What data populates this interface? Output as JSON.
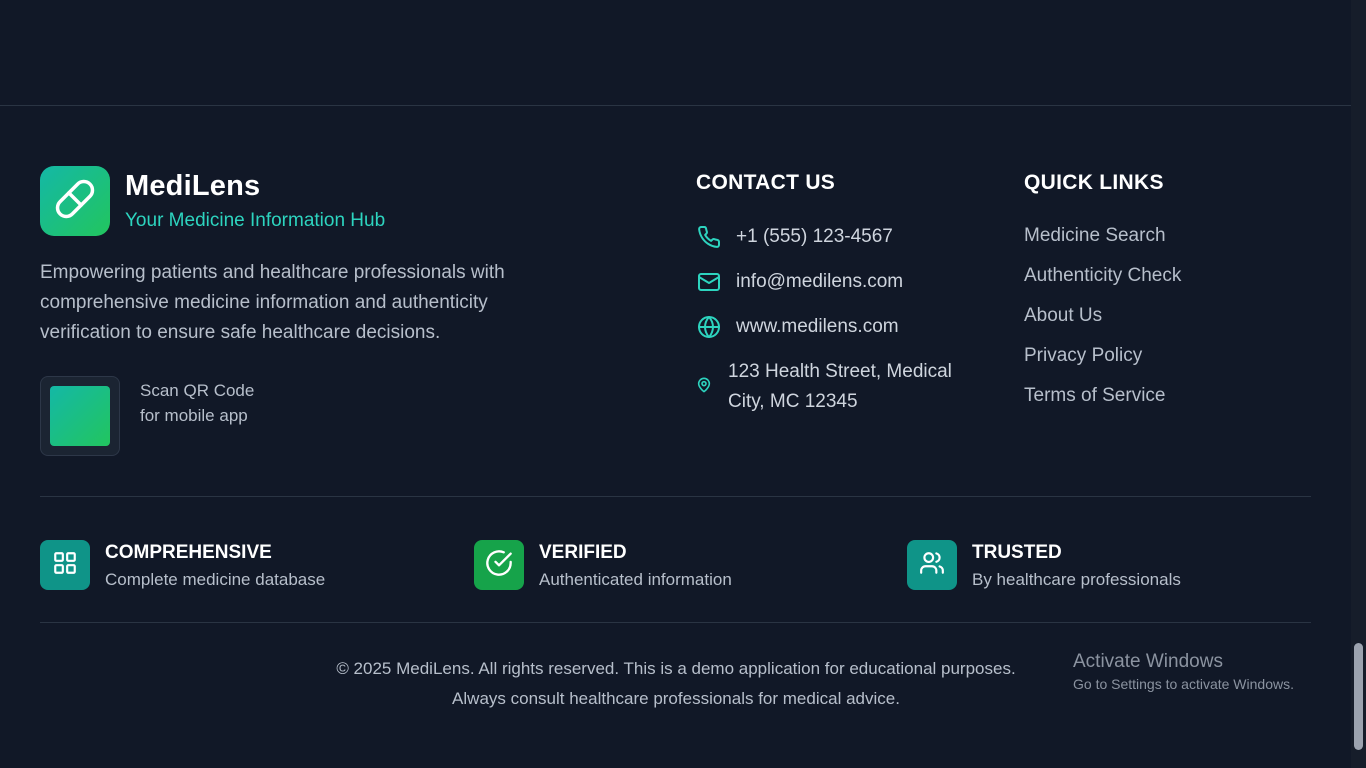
{
  "brand": {
    "name": "MediLens",
    "tagline": "Your Medicine Information Hub",
    "description": "Empowering patients and healthcare professionals with comprehensive medicine information and authenticity verification to ensure safe healthcare decisions.",
    "qr_line1": "Scan QR Code",
    "qr_line2": "for mobile app",
    "logo_icon": "pill-icon",
    "accent_color": "#2dd4bf"
  },
  "contact": {
    "title": "CONTACT US",
    "phone": "+1 (555) 123-4567",
    "email": "info@medilens.com",
    "website": "www.medilens.com",
    "address": "123 Health Street, Medical City, MC 12345"
  },
  "quick_links": {
    "title": "QUICK LINKS",
    "items": [
      {
        "label": "Medicine Search"
      },
      {
        "label": "Authenticity Check"
      },
      {
        "label": "About Us"
      },
      {
        "label": "Privacy Policy"
      },
      {
        "label": "Terms of Service"
      }
    ]
  },
  "features": [
    {
      "title": "COMPREHENSIVE",
      "subtitle": "Complete medicine database",
      "icon": "grid-icon",
      "color": "#0f9488"
    },
    {
      "title": "VERIFIED",
      "subtitle": "Authenticated information",
      "icon": "check-circle-icon",
      "color": "#16a34a"
    },
    {
      "title": "TRUSTED",
      "subtitle": "By healthcare professionals",
      "icon": "users-icon",
      "color": "#0f9488"
    }
  ],
  "footer": {
    "copyright_line1": "© 2025 MediLens. All rights reserved. This is a demo application for educational purposes.",
    "copyright_line2": "Always consult healthcare professionals for medical advice."
  },
  "windows_watermark": {
    "title": "Activate Windows",
    "subtitle": "Go to Settings to activate Windows."
  }
}
